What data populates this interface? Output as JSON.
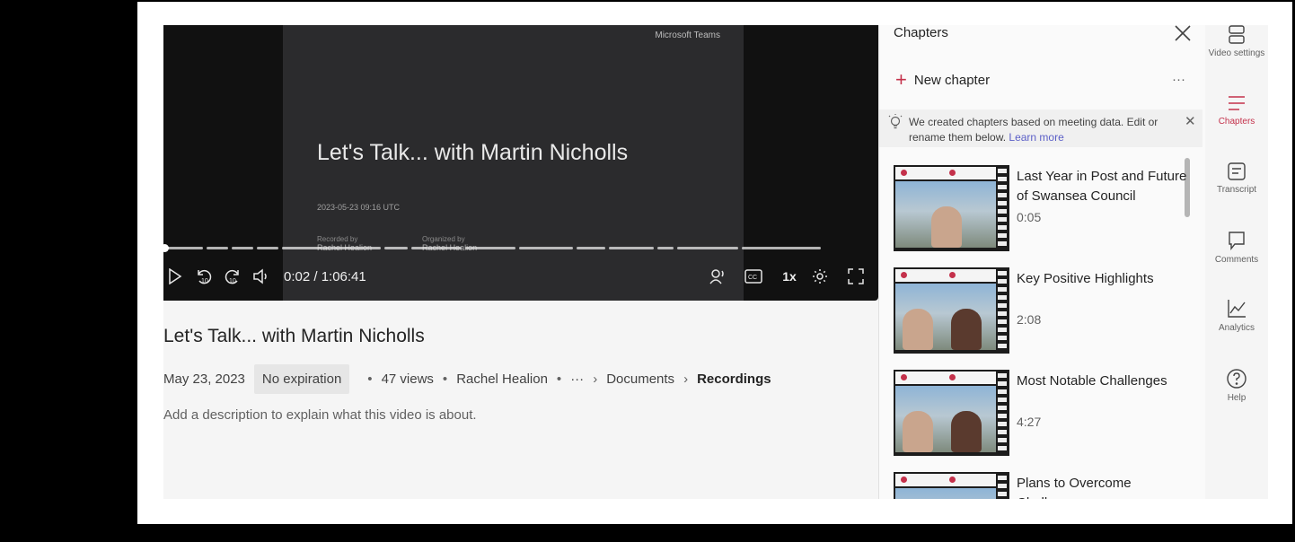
{
  "player": {
    "slide_brand": "Microsoft Teams",
    "slide_title": "Let's Talk... with Martin Nicholls",
    "slide_date": "2023-05-23 09:16 UTC",
    "slide_recorded_by_label": "Recorded by",
    "slide_recorded_by": "Rachel Healion",
    "slide_organized_by_label": "Organized by",
    "slide_organized_by": "Rachel Healion",
    "time_display": "0:02 / 1:06:41",
    "playback_rate": "1x",
    "progress_fraction": 0.0005,
    "icons": [
      "play-icon",
      "rewind-10-icon",
      "forward-10-icon",
      "volume-icon",
      "speaker-coach-icon",
      "captions-icon",
      "settings-gear-icon",
      "fullscreen-icon"
    ]
  },
  "video": {
    "title": "Let's Talk... with Martin Nicholls",
    "date": "May 23, 2023",
    "expiration": "No expiration",
    "views": "47 views",
    "owner": "Rachel Healion",
    "breadcrumb_more": "···",
    "breadcrumb": [
      "Documents",
      "Recordings"
    ],
    "description_placeholder": "Add a description to explain what this video is about."
  },
  "chapters": {
    "heading": "Chapters",
    "new_chapter_label": "New chapter",
    "more_label": "···",
    "info_text": "We created chapters based on meeting data. Edit or rename them below.",
    "info_link": "Learn more",
    "items": [
      {
        "title": "Last Year in Post and Future of Swansea Council",
        "time": "0:05"
      },
      {
        "title": "Key Positive Highlights",
        "time": "2:08"
      },
      {
        "title": "Most Notable Challenges",
        "time": "4:27"
      },
      {
        "title": "Plans to Overcome Challenges",
        "time": ""
      }
    ]
  },
  "rail": {
    "items": [
      {
        "label": "Video settings",
        "icon": "video-settings-icon"
      },
      {
        "label": "Chapters",
        "icon": "chapters-icon",
        "active": true
      },
      {
        "label": "Transcript",
        "icon": "transcript-icon"
      },
      {
        "label": "Comments",
        "icon": "comments-icon"
      },
      {
        "label": "Analytics",
        "icon": "analytics-icon"
      },
      {
        "label": "Help",
        "icon": "help-icon"
      }
    ]
  },
  "colors": {
    "accent": "#c4314b",
    "link": "#5b5fc7",
    "player_bg": "#111111",
    "slide_bg": "#2b2b2d"
  }
}
